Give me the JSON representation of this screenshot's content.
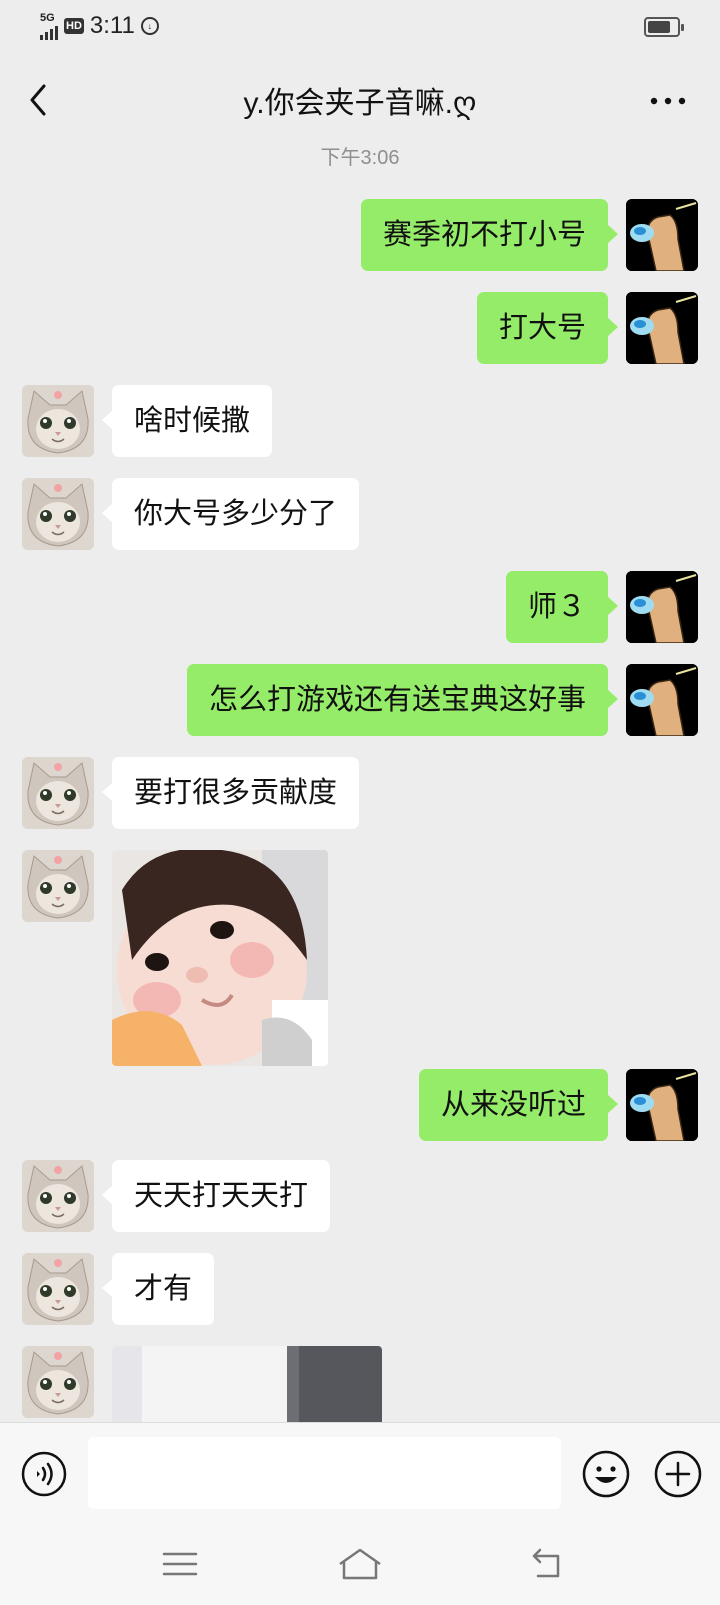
{
  "status_bar": {
    "network": "5G",
    "hd_badge": "HD",
    "time": "3:11",
    "battery_level": 0.8
  },
  "header": {
    "title": "y.你会夹子音嘛.ღ",
    "back_icon": "chevron-left-icon",
    "more_icon": "more-dots-icon"
  },
  "chat": {
    "timestamp": "下午3:06",
    "messages": [
      {
        "from": "me",
        "text": "赛季初不打小号"
      },
      {
        "from": "me",
        "text": "打大号"
      },
      {
        "from": "them",
        "text": "啥时候撒"
      },
      {
        "from": "them",
        "text": "你大号多少分了"
      },
      {
        "from": "me",
        "text": "师３"
      },
      {
        "from": "me",
        "text": "怎么打游戏还有送宝典这好事"
      },
      {
        "from": "them",
        "text": "要打很多贡献度"
      },
      {
        "from": "them",
        "type": "image",
        "subject": "baby-photo"
      },
      {
        "from": "me",
        "text": "从来没听过"
      },
      {
        "from": "them",
        "text": "天天打天天打"
      },
      {
        "from": "them",
        "text": "才有"
      },
      {
        "from": "them",
        "type": "image",
        "subject": "photo-partial"
      }
    ]
  },
  "input_bar": {
    "voice_icon": "voice-icon",
    "message_value": "",
    "emoji_icon": "emoji-icon",
    "plus_icon": "plus-icon"
  },
  "system_nav": {
    "menu_icon": "menu-icon",
    "home_icon": "home-icon",
    "back_icon": "back-icon"
  },
  "colors": {
    "background": "#ededed",
    "my_bubble": "#95ec69",
    "their_bubble": "#ffffff",
    "timestamp_text": "#8f8f8f"
  }
}
